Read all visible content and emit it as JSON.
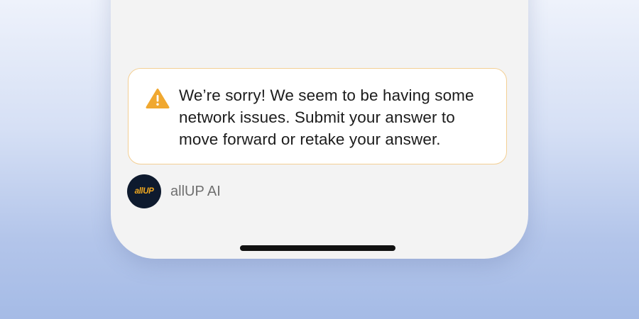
{
  "alert": {
    "icon": "warning-triangle-icon",
    "message": "We’re sorry! We seem to be having some network issues. Submit your answer to move forward or retake your answer."
  },
  "sender": {
    "avatar_logo": "allUP",
    "name": "allUP AI"
  },
  "colors": {
    "warning_icon": "#f0a830",
    "alert_border": "#f3cf94",
    "avatar_background": "#0e1a2e",
    "avatar_logo": "#f2a91f"
  }
}
